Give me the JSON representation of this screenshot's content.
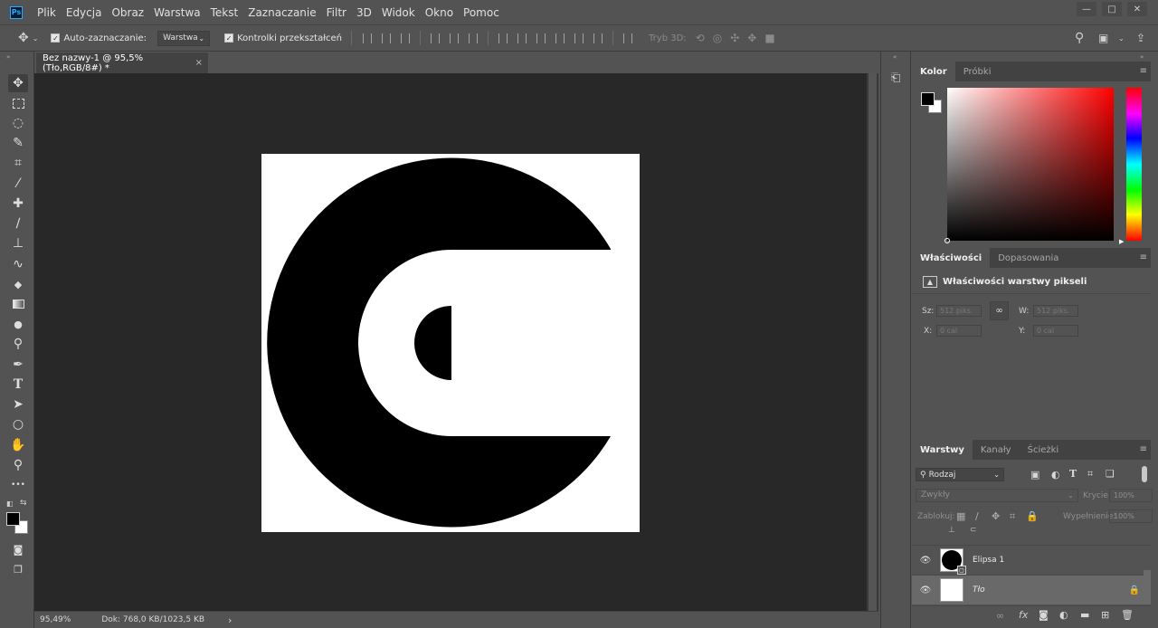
{
  "menubar": {
    "logo": "Ps",
    "items": [
      "Plik",
      "Edycja",
      "Obraz",
      "Warstwa",
      "Tekst",
      "Zaznaczanie",
      "Filtr",
      "3D",
      "Widok",
      "Okno",
      "Pomoc"
    ],
    "window_controls": [
      "—",
      "□",
      "✕"
    ]
  },
  "options": {
    "auto_select_label": "Auto-zaznaczanie:",
    "auto_select_target": "Warstwa",
    "transform_controls_label": "Kontrolki przekształceń",
    "mode_3d_label": "Tryb 3D:"
  },
  "document": {
    "tab_title": "Bez nazwy-1 @ 95,5% (Tło,RGB/8#) *",
    "close_glyph": "×",
    "zoom": "95,49%",
    "doc_info": "Dok: 768,0 KB/1023,5 KB",
    "status_arrow": "›"
  },
  "color_panel": {
    "tabs": [
      "Kolor",
      "Próbki"
    ],
    "active_tab": 0,
    "foreground_color": "#000000",
    "background_color": "#ffffff",
    "picker_hue": "#ff0000"
  },
  "properties_panel": {
    "tabs": [
      "Właściwości",
      "Dopasowania"
    ],
    "active_tab": 0,
    "heading": "Właściwości warstwy pikseli",
    "width_label": "Sz:",
    "width_value": "512 piks.",
    "height_label": "W:",
    "height_value": "512 piks.",
    "x_label": "X:",
    "x_value": "0 cal",
    "y_label": "Y:",
    "y_value": "0 cal"
  },
  "layers_panel": {
    "tabs": [
      "Warstwy",
      "Kanały",
      "Ścieżki"
    ],
    "active_tab": 0,
    "filter_kind": "Rodzaj",
    "blend_mode": "Zwykły",
    "opacity_label": "Krycie:",
    "opacity_value": "100%",
    "lock_label": "Zablokuj:",
    "fill_label": "Wypełnienie:",
    "fill_value": "100%",
    "layers": [
      {
        "name": "Elipsa 1",
        "visible": true,
        "selected": false
      },
      {
        "name": "Tło",
        "visible": true,
        "selected": true,
        "locked": true
      }
    ]
  },
  "tools": [
    {
      "icon": "move-icon",
      "glyph": "✥",
      "active": true
    },
    {
      "icon": "marquee-icon",
      "glyph": "⬚"
    },
    {
      "icon": "lasso-icon",
      "glyph": "◌"
    },
    {
      "icon": "quick-select-icon",
      "glyph": "✎"
    },
    {
      "icon": "crop-icon",
      "glyph": "⌗"
    },
    {
      "icon": "eyedropper-icon",
      "glyph": "⁄"
    },
    {
      "icon": "healing-icon",
      "glyph": "✚"
    },
    {
      "icon": "brush-icon",
      "glyph": "∕"
    },
    {
      "icon": "stamp-icon",
      "glyph": "⊥"
    },
    {
      "icon": "history-brush-icon",
      "glyph": "∿"
    },
    {
      "icon": "eraser-icon",
      "glyph": "◆"
    },
    {
      "icon": "gradient-icon",
      "glyph": "▭"
    },
    {
      "icon": "blur-icon",
      "glyph": "●"
    },
    {
      "icon": "dodge-icon",
      "glyph": "⚲"
    },
    {
      "icon": "pen-icon",
      "glyph": "✒"
    },
    {
      "icon": "type-icon",
      "glyph": "T"
    },
    {
      "icon": "path-select-icon",
      "glyph": "➤"
    },
    {
      "icon": "ellipse-icon",
      "glyph": "○"
    },
    {
      "icon": "hand-icon",
      "glyph": "✋"
    },
    {
      "icon": "zoom-icon",
      "glyph": "⚲"
    },
    {
      "icon": "more-tools-icon",
      "glyph": "•••"
    }
  ]
}
